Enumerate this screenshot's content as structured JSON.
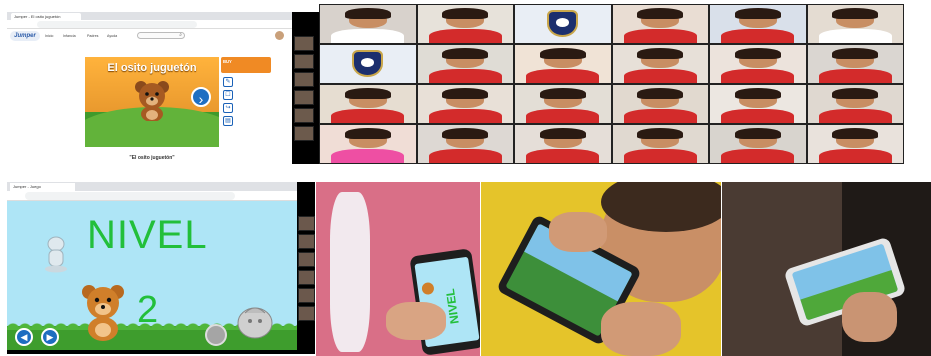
{
  "layout_panels": [
    "browser-game-intro",
    "video-call-grid",
    "browser-game-level",
    "photo-child-tablet-1",
    "photo-child-tablet-2",
    "photo-child-tablet-3"
  ],
  "shot1": {
    "tab_title": "Jumper - El osito juguetón",
    "url": "",
    "logo": "Jumper",
    "nav": [
      "Inicio",
      "Infancia",
      "Padres",
      "Ayuda"
    ],
    "search_icon": "search-icon",
    "game_title": "El osito juguetón",
    "credit": "",
    "side_buy": "BUY",
    "side_buy_sub": "",
    "side_items": [
      {
        "icon": "edit-icon",
        "label": ""
      },
      {
        "icon": "comment-icon",
        "label": ""
      },
      {
        "icon": "share-icon",
        "label": ""
      },
      {
        "icon": "book-icon",
        "label": ""
      }
    ],
    "caption": "\"El osito juguetón\"",
    "timestamp": ""
  },
  "grid1": {
    "timestamp": "",
    "cells": [
      {
        "type": "person",
        "bg": "#d8d2cc",
        "shirt": "#ffffff"
      },
      {
        "type": "person",
        "bg": "#e7e2da",
        "shirt": "#d32b2b"
      },
      {
        "type": "crest"
      },
      {
        "type": "person",
        "bg": "#e9ddd3",
        "shirt": "#d32b2b"
      },
      {
        "type": "person",
        "bg": "#d9e0ea",
        "shirt": "#d32b2b"
      },
      {
        "type": "person",
        "bg": "#e4dcd2",
        "shirt": "#ffffff"
      },
      {
        "type": "crest"
      },
      {
        "type": "person",
        "bg": "#dfdcd5",
        "shirt": "#d32b2b"
      },
      {
        "type": "person",
        "bg": "#f0e3d6",
        "shirt": "#d32b2b"
      },
      {
        "type": "person",
        "bg": "#e7e0d8",
        "shirt": "#d32b2b"
      },
      {
        "type": "person",
        "bg": "#ece3dc",
        "shirt": "#d32b2b"
      },
      {
        "type": "person",
        "bg": "#dad6d1",
        "shirt": "#d32b2b"
      },
      {
        "type": "person",
        "bg": "#e6ddd1",
        "shirt": "#d32b2b"
      },
      {
        "type": "person",
        "bg": "#e8e0d7",
        "shirt": "#d32b2b"
      },
      {
        "type": "person",
        "bg": "#e3ded6",
        "shirt": "#d32b2b"
      },
      {
        "type": "person",
        "bg": "#e1d9cf",
        "shirt": "#d32b2b"
      },
      {
        "type": "person",
        "bg": "#ece7e1",
        "shirt": "#d32b2b"
      },
      {
        "type": "person",
        "bg": "#dfd8d0",
        "shirt": "#d32b2b"
      },
      {
        "type": "person",
        "bg": "#f0ddd6",
        "shirt": "#ee4fa3"
      },
      {
        "type": "person",
        "bg": "#ddd8d3",
        "shirt": "#d32b2b"
      },
      {
        "type": "person",
        "bg": "#e5ded8",
        "shirt": "#d32b2b"
      },
      {
        "type": "person",
        "bg": "#e0d9d0",
        "shirt": "#d32b2b"
      },
      {
        "type": "person",
        "bg": "#d8d4ce",
        "shirt": "#d32b2b"
      },
      {
        "type": "person",
        "bg": "#e9e2dc",
        "shirt": "#d32b2b"
      }
    ]
  },
  "shot2": {
    "tab_title": "Jumper - Juego",
    "url": "",
    "level_label": "NIVEL",
    "level_number": "2",
    "prev_icon": "arrow-left-icon",
    "next_icon": "arrow-right-icon",
    "timestamp": ""
  },
  "photos": {
    "photo1_screen_text": "NIVEL",
    "colors": {
      "game_green": "#22bf3a",
      "game_sky": "#aee5f6",
      "brand_orange": "#f08a24",
      "jumper_blue": "#1e6dc0"
    }
  }
}
